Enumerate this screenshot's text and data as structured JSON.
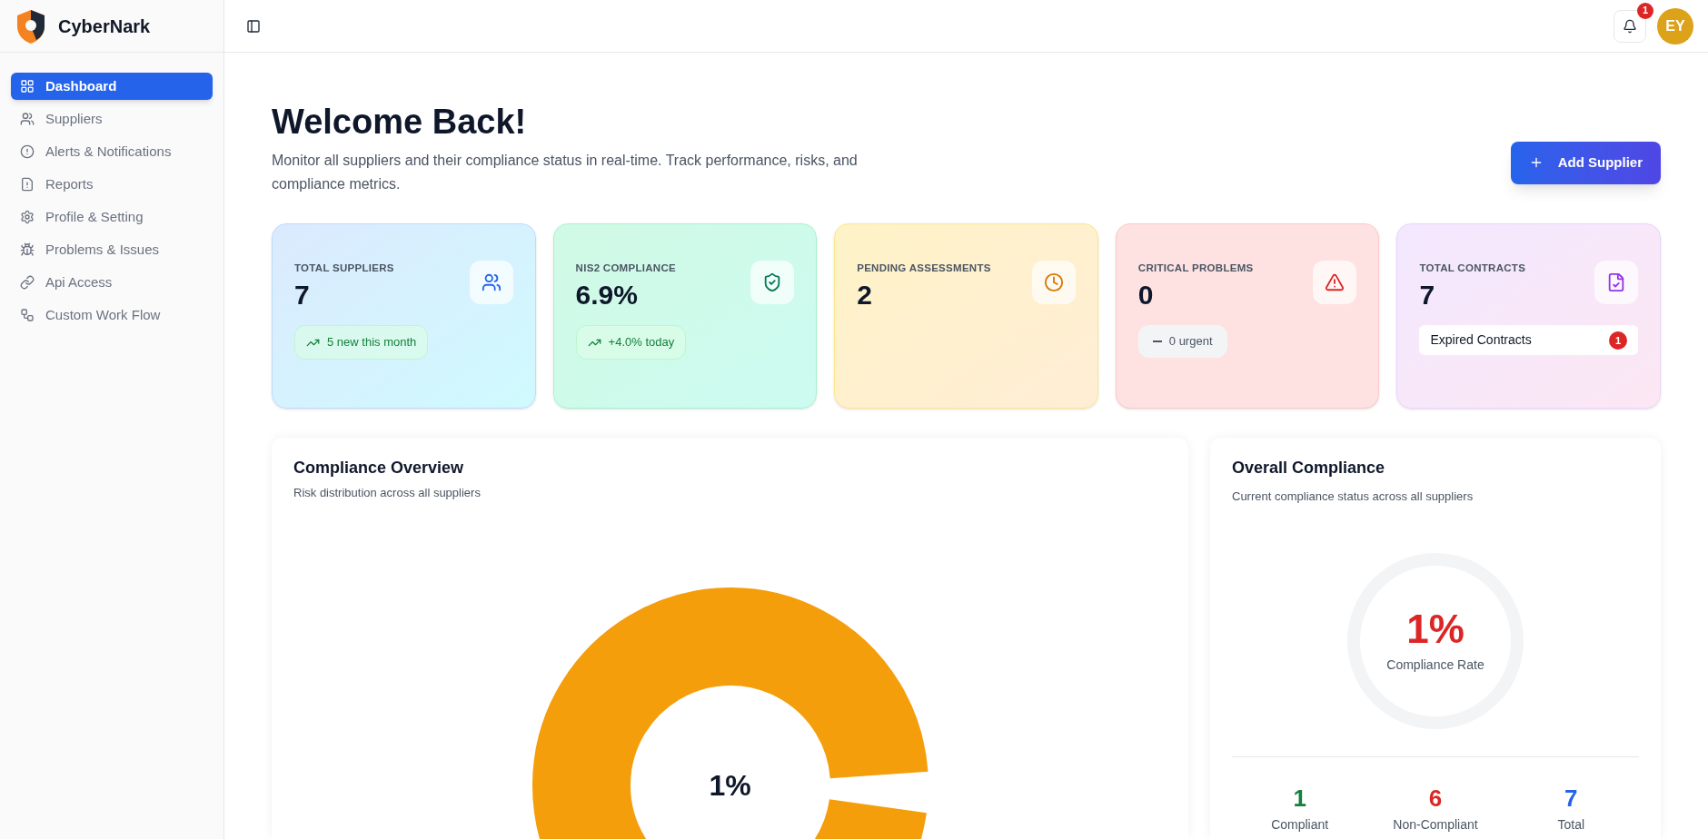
{
  "brand": {
    "name": "CyberNark"
  },
  "sidebar": {
    "items": [
      {
        "label": "Dashboard",
        "selected": true
      },
      {
        "label": "Suppliers",
        "selected": false
      },
      {
        "label": "Alerts & Notifications",
        "selected": false
      },
      {
        "label": "Reports",
        "selected": false
      },
      {
        "label": "Profile & Setting",
        "selected": false
      },
      {
        "label": "Problems & Issues",
        "selected": false
      },
      {
        "label": "Api Access",
        "selected": false
      },
      {
        "label": "Custom Work Flow",
        "selected": false
      }
    ]
  },
  "header": {
    "notification_count": "1",
    "avatar_initials": "EY"
  },
  "welcome": {
    "title": "Welcome Back!",
    "subtitle": "Monitor all suppliers and their compliance status in real-time. Track performance, risks, and compliance metrics.",
    "button": "Add Supplier"
  },
  "cards": [
    {
      "kind": "trend",
      "title": "TOTAL SUPPLIERS",
      "value": "7",
      "badge": "5 new this month"
    },
    {
      "kind": "trend",
      "title": "NIS2 COMPLIANCE",
      "value": "6.9%",
      "badge": "+4.0% today"
    },
    {
      "kind": "plain",
      "title": "PENDING ASSESSMENTS",
      "value": "2"
    },
    {
      "kind": "neutral",
      "title": "CRITICAL PROBLEMS",
      "value": "0",
      "badge": "0 urgent"
    },
    {
      "kind": "contracts",
      "title": "TOTAL CONTRACTS",
      "value": "7",
      "badge": "Expired Contracts",
      "count": "1"
    }
  ],
  "compliance_overview": {
    "title": "Compliance Overview",
    "subtitle": "Risk distribution across all suppliers",
    "center_label": "1%"
  },
  "overall_compliance": {
    "title": "Overall Compliance",
    "subtitle": "Current compliance status across all suppliers",
    "rate": "1%",
    "rate_label": "Compliance Rate",
    "stats": [
      {
        "value": "1",
        "label": "Compliant",
        "color": "#15803d"
      },
      {
        "value": "6",
        "label": "Non-Compliant",
        "color": "#dc2626"
      },
      {
        "value": "7",
        "label": "Total",
        "color": "#2563eb"
      }
    ]
  }
}
